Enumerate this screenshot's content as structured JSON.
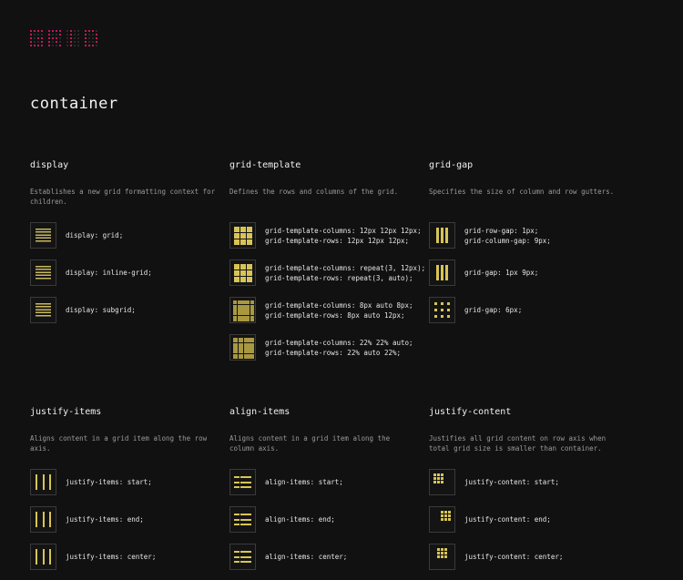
{
  "logo": {
    "text": "GRID"
  },
  "section": {
    "title": "container"
  },
  "colors": {
    "background": "#111111",
    "accent": "#d8c456",
    "logo": "#c2185b"
  },
  "properties": [
    {
      "name": "display",
      "description": "Establishes a new grid formatting context for children.",
      "examples": [
        {
          "code": "display: grid;",
          "icon": "grid-lines-icon"
        },
        {
          "code": "display: inline-grid;",
          "icon": "grid-lines-icon"
        },
        {
          "code": "display: subgrid;",
          "icon": "grid-lines-icon"
        }
      ]
    },
    {
      "name": "grid-template",
      "description": "Defines the rows and columns of the grid.",
      "examples": [
        {
          "code": "grid-template-columns: 12px 12px 12px;\ngrid-template-rows: 12px 12px 12px;",
          "icon": "grid-3x3-icon"
        },
        {
          "code": "grid-template-columns: repeat(3, 12px);\ngrid-template-rows: repeat(3, auto);",
          "icon": "grid-3x3-icon"
        },
        {
          "code": "grid-template-columns: 8px auto 8px;\ngrid-template-rows: 8px auto 12px;",
          "icon": "grid-uneven-icon"
        },
        {
          "code": "grid-template-columns: 22% 22% auto;\ngrid-template-rows: 22% auto 22%;",
          "icon": "grid-percent-icon"
        }
      ]
    },
    {
      "name": "grid-gap",
      "description": "Specifies the size of column and row gutters.",
      "examples": [
        {
          "code": "grid-row-gap: 1px;\ngrid-column-gap: 9px;",
          "icon": "gap-columns-icon"
        },
        {
          "code": "grid-gap: 1px 9px;",
          "icon": "gap-columns-icon"
        },
        {
          "code": "grid-gap: 6px;",
          "icon": "gap-squares-icon"
        }
      ]
    },
    {
      "name": "justify-items",
      "description": "Aligns content in a grid item along the row axis.",
      "examples": [
        {
          "code": "justify-items: start;",
          "icon": "justify-start-icon"
        },
        {
          "code": "justify-items: end;",
          "icon": "justify-end-icon"
        },
        {
          "code": "justify-items: center;",
          "icon": "justify-center-icon"
        }
      ]
    },
    {
      "name": "align-items",
      "description": "Aligns content in a grid item along the column axis.",
      "examples": [
        {
          "code": "align-items: start;",
          "icon": "align-start-icon"
        },
        {
          "code": "align-items: end;",
          "icon": "align-end-icon"
        },
        {
          "code": "align-items: center;",
          "icon": "align-center-icon"
        }
      ]
    },
    {
      "name": "justify-content",
      "description": "Justifies all grid content on row axis when total grid size is smaller than container.",
      "examples": [
        {
          "code": "justify-content: start;",
          "icon": "content-start-icon"
        },
        {
          "code": "justify-content: end;",
          "icon": "content-end-icon"
        },
        {
          "code": "justify-content: center;",
          "icon": "content-center-icon"
        }
      ]
    }
  ]
}
